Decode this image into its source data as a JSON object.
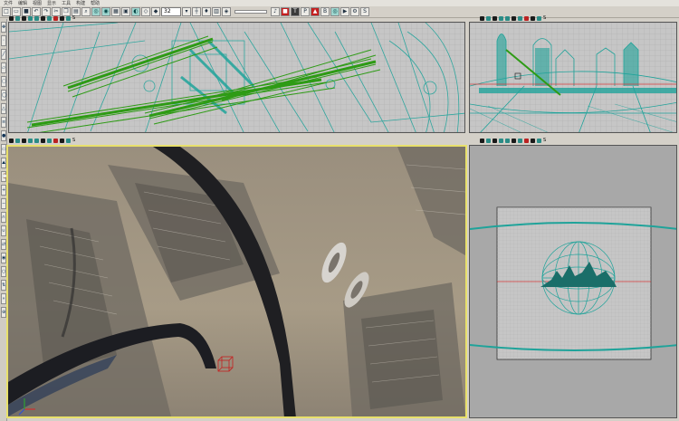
{
  "menubar": [
    "文件",
    "编辑",
    "视图",
    "显示",
    "工具",
    "构建",
    "帮助"
  ],
  "toolbar": {
    "grid_select_value": "32",
    "texture_button": "T",
    "paint_button": "P",
    "brush_button": "B",
    "count_label": "S"
  },
  "viewport_header": {
    "count_label": "S"
  },
  "colors": {
    "wire": "#1fa39a",
    "green_mesh": "#2e9b15",
    "grid_bg": "#c4c4c4",
    "selected_border": "#e8e06b"
  }
}
